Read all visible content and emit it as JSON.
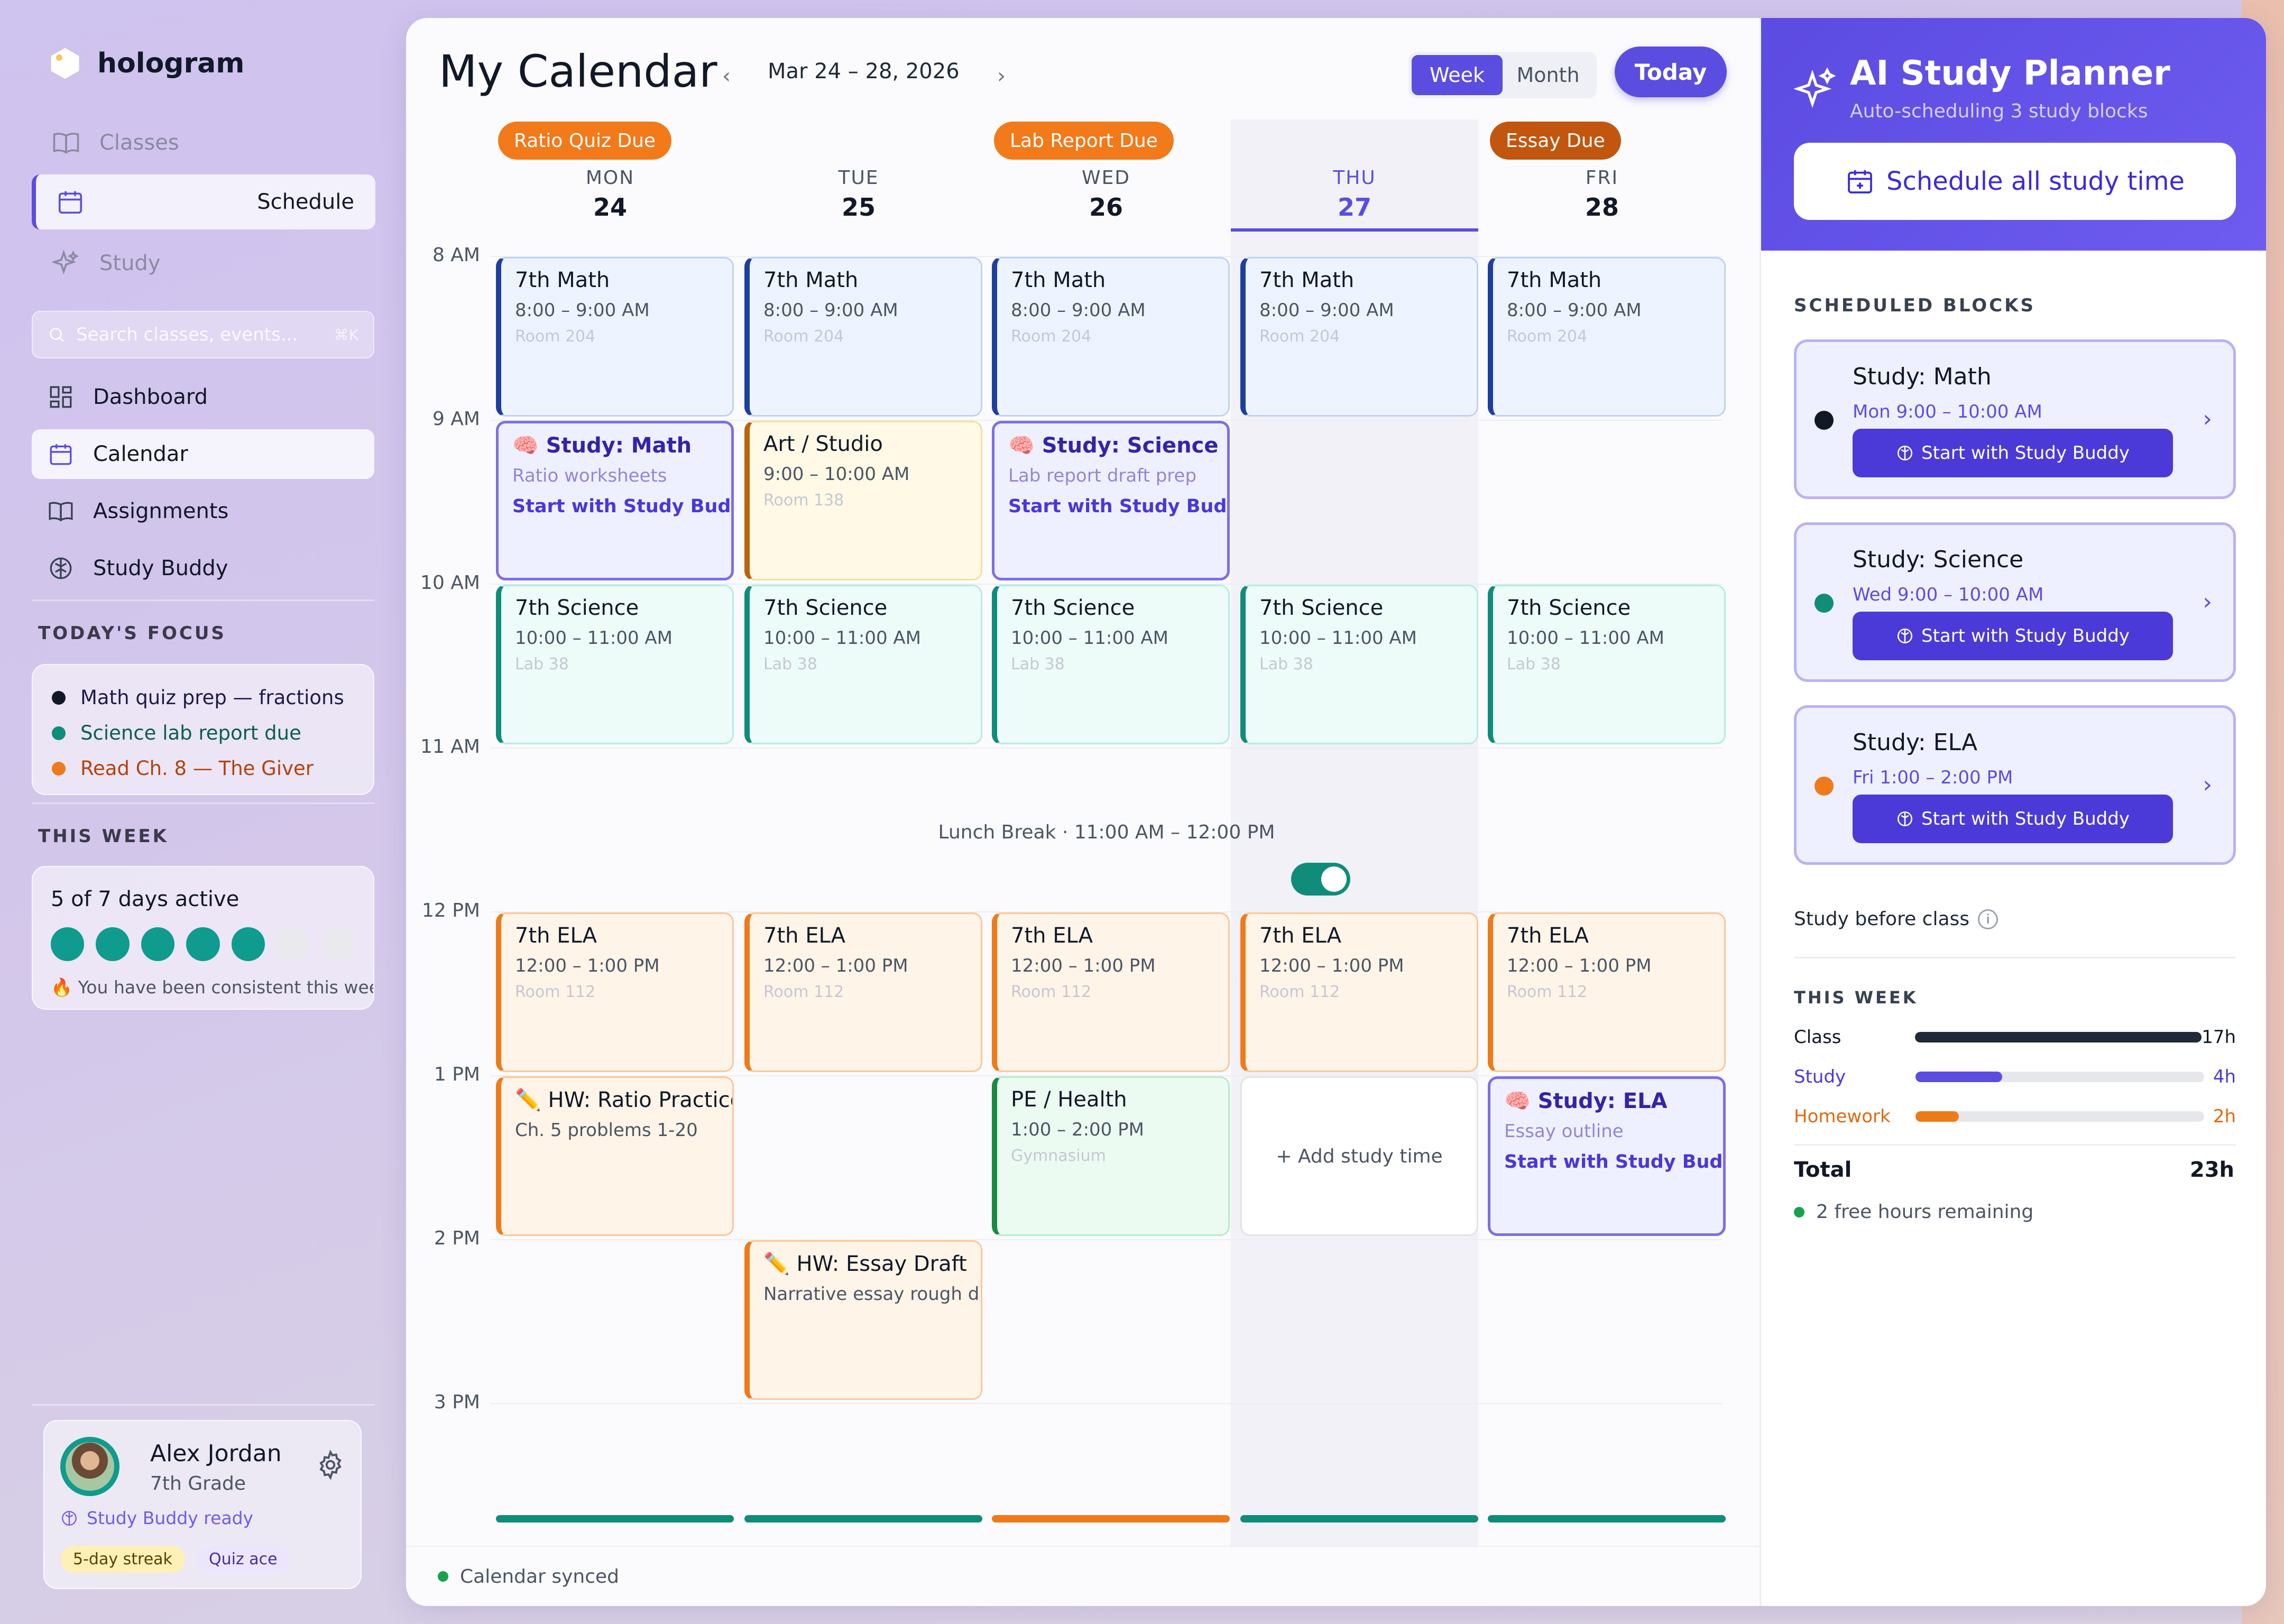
{
  "app": {
    "name": "hologram"
  },
  "sidebar": {
    "top_nav": [
      {
        "label": "Classes",
        "icon": "book-icon"
      },
      {
        "label": "Schedule",
        "icon": "calendar-icon"
      },
      {
        "label": "Study",
        "icon": "sparkles-icon"
      }
    ],
    "search": {
      "placeholder": "Search classes, events...",
      "shortcut": "⌘K"
    },
    "main_nav": [
      {
        "label": "Dashboard",
        "icon": "grid-icon"
      },
      {
        "label": "Calendar",
        "icon": "calendar-icon"
      },
      {
        "label": "Assignments",
        "icon": "book-icon"
      },
      {
        "label": "Study Buddy",
        "icon": "brain-icon"
      }
    ],
    "focus_title": "TODAY'S FOCUS",
    "focus": [
      {
        "text": "Math quiz prep — fractions",
        "color": "#111827",
        "text_color": "#1e1b4b"
      },
      {
        "text": "Science lab report due",
        "color": "#0f8c7a",
        "text_color": "#0b5e52"
      },
      {
        "text": "Read Ch. 8 — The Giver",
        "color": "#ef7a1a",
        "text_color": "#b4420a"
      }
    ],
    "week_title": "THIS WEEK",
    "days_active": "5 of 7 days active",
    "active_days": 5,
    "total_days": 7,
    "week_message": "🔥 You have been consistent this week — r",
    "profile": {
      "name": "Alex Jordan",
      "grade": "7th Grade",
      "status": "Study Buddy ready",
      "badges": [
        "5-day streak",
        "Quiz ace"
      ]
    }
  },
  "calendar": {
    "title": "My Calendar",
    "date_range": "Mar 24 – 28, 2026",
    "view_week": "Week",
    "view_month": "Month",
    "today_label": "Today",
    "due_badges": [
      {
        "day": 0,
        "label": "Ratio Quiz Due",
        "color": "#f27a1a"
      },
      {
        "day": 2,
        "label": "Lab Report Due",
        "color": "#f27a1a"
      },
      {
        "day": 4,
        "label": "Essay Due",
        "color": "#c2560f"
      }
    ],
    "days": [
      {
        "name": "MON",
        "date": "24"
      },
      {
        "name": "TUE",
        "date": "25"
      },
      {
        "name": "WED",
        "date": "26"
      },
      {
        "name": "THU",
        "date": "27",
        "today": true
      },
      {
        "name": "FRI",
        "date": "28"
      }
    ],
    "time_labels": [
      "8 AM",
      "9 AM",
      "10 AM",
      "11 AM",
      "12 PM",
      "1 PM",
      "2 PM",
      "3 PM"
    ],
    "lunch": "Lunch Break · 11:00 AM – 12:00 PM",
    "add_study": "+ Add study time",
    "day_bar_colors": [
      "#0f8c7a",
      "#0f8c7a",
      "#ef7a1a",
      "#0f8c7a",
      "#0f8c7a"
    ],
    "footer_status": "Calendar synced"
  },
  "events": [
    {
      "day": 0,
      "start": 8,
      "end": 9,
      "type": "blue",
      "title": "7th Math",
      "time": "8:00 – 9:00 AM",
      "room": "Room 204"
    },
    {
      "day": 1,
      "start": 8,
      "end": 9,
      "type": "blue",
      "title": "7th Math",
      "time": "8:00 – 9:00 AM",
      "room": "Room 204"
    },
    {
      "day": 2,
      "start": 8,
      "end": 9,
      "type": "blue",
      "title": "7th Math",
      "time": "8:00 – 9:00 AM",
      "room": "Room 204"
    },
    {
      "day": 3,
      "start": 8,
      "end": 9,
      "type": "blue",
      "title": "7th Math",
      "time": "8:00 – 9:00 AM",
      "room": "Room 204"
    },
    {
      "day": 4,
      "start": 8,
      "end": 9,
      "type": "blue",
      "title": "7th Math",
      "time": "8:00 – 9:00 AM",
      "room": "Room 204"
    },
    {
      "day": 0,
      "start": 9,
      "end": 10,
      "type": "study",
      "title": "🧠 Study: Math",
      "time": "Ratio worksheets",
      "link": "Start with Study Buddy →"
    },
    {
      "day": 1,
      "start": 9,
      "end": 10,
      "type": "yellow",
      "title": "Art / Studio",
      "time": "9:00 – 10:00 AM",
      "room": "Room 138"
    },
    {
      "day": 2,
      "start": 9,
      "end": 10,
      "type": "study",
      "title": "🧠 Study: Science",
      "time": "Lab report draft prep",
      "link": "Start with Study Buddy →"
    },
    {
      "day": 0,
      "start": 10,
      "end": 11,
      "type": "teal",
      "title": "7th Science",
      "time": "10:00 – 11:00 AM",
      "room": "Lab 38"
    },
    {
      "day": 1,
      "start": 10,
      "end": 11,
      "type": "teal",
      "title": "7th Science",
      "time": "10:00 – 11:00 AM",
      "room": "Lab 38"
    },
    {
      "day": 2,
      "start": 10,
      "end": 11,
      "type": "teal",
      "title": "7th Science",
      "time": "10:00 – 11:00 AM",
      "room": "Lab 38"
    },
    {
      "day": 3,
      "start": 10,
      "end": 11,
      "type": "teal",
      "title": "7th Science",
      "time": "10:00 – 11:00 AM",
      "room": "Lab 38"
    },
    {
      "day": 4,
      "start": 10,
      "end": 11,
      "type": "teal",
      "title": "7th Science",
      "time": "10:00 – 11:00 AM",
      "room": "Lab 38"
    },
    {
      "day": 0,
      "start": 12,
      "end": 13,
      "type": "orange",
      "title": "7th ELA",
      "time": "12:00 – 1:00 PM",
      "room": "Room 112"
    },
    {
      "day": 1,
      "start": 12,
      "end": 13,
      "type": "orange",
      "title": "7th ELA",
      "time": "12:00 – 1:00 PM",
      "room": "Room 112"
    },
    {
      "day": 2,
      "start": 12,
      "end": 13,
      "type": "orange",
      "title": "7th ELA",
      "time": "12:00 – 1:00 PM",
      "room": "Room 112"
    },
    {
      "day": 3,
      "start": 12,
      "end": 13,
      "type": "orange",
      "title": "7th ELA",
      "time": "12:00 – 1:00 PM",
      "room": "Room 112"
    },
    {
      "day": 4,
      "start": 12,
      "end": 13,
      "type": "orange",
      "title": "7th ELA",
      "time": "12:00 – 1:00 PM",
      "room": "Room 112"
    },
    {
      "day": 0,
      "start": 13,
      "end": 14,
      "type": "orange",
      "title": "✏️ HW: Ratio Practice",
      "time": "Ch. 5 problems 1-20"
    },
    {
      "day": 2,
      "start": 13,
      "end": 14,
      "type": "green",
      "title": "PE / Health",
      "time": "1:00 – 2:00 PM",
      "room": "Gymnasium"
    },
    {
      "day": 3,
      "start": 13,
      "end": 14,
      "type": "add",
      "title": "+ Add study time"
    },
    {
      "day": 4,
      "start": 13,
      "end": 14,
      "type": "study",
      "title": "🧠 Study: ELA",
      "time": "Essay outline",
      "link": "Start with Study Buddy →"
    },
    {
      "day": 1,
      "start": 14,
      "end": 15,
      "type": "orange",
      "title": "✏️ HW: Essay Draft",
      "time": "Narrative essay rough draft"
    }
  ],
  "planner": {
    "title": "AI Study Planner",
    "subtitle": "Auto-scheduling 3 study blocks",
    "schedule_button": "Schedule all study time",
    "blocks_title": "SCHEDULED BLOCKS",
    "blocks": [
      {
        "name": "Study: Math",
        "time": "Mon 9:00 – 10:00 AM",
        "color": "#111827",
        "button": "Start with Study Buddy"
      },
      {
        "name": "Study: Science",
        "time": "Wed 9:00 – 10:00 AM",
        "color": "#0f8c7a",
        "button": "Start with Study Buddy"
      },
      {
        "name": "Study: ELA",
        "time": "Fri 1:00 – 2:00 PM",
        "color": "#ef7a1a",
        "button": "Start with Study Buddy"
      }
    ],
    "toggle_label": "Study before class",
    "toggle_on": true,
    "week_title": "THIS WEEK",
    "stats": [
      {
        "label": "Class",
        "value": "17h",
        "fraction": 1.0,
        "color": "#1f2937",
        "label_color": "#111827"
      },
      {
        "label": "Study",
        "value": "4h",
        "fraction": 0.3,
        "color": "#5b4de0",
        "label_color": "#4b3ad8"
      },
      {
        "label": "Homework",
        "value": "2h",
        "fraction": 0.15,
        "color": "#ef7a1a",
        "label_color": "#e06a10"
      }
    ],
    "total_label": "Total",
    "total_value": "23h",
    "free_hours": "2 free hours remaining"
  }
}
